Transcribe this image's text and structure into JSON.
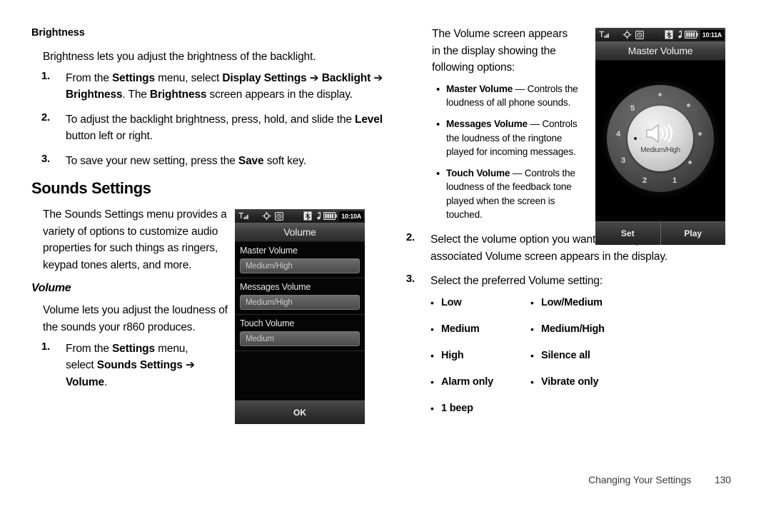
{
  "left_column": {
    "brightness_heading": "Brightness",
    "brightness_intro": "Brightness lets you adjust the brightness of the backlight.",
    "brightness_steps": [
      {
        "num": "1.",
        "parts": [
          {
            "t": "From the ",
            "b": false
          },
          {
            "t": "Settings",
            "b": true
          },
          {
            "t": " menu, select ",
            "b": false
          },
          {
            "t": "Display Settings ➔",
            "b": true
          },
          {
            "t": " ",
            "b": false
          },
          {
            "t": "Backlight ➔ Brightness",
            "b": true
          },
          {
            "t": ". The ",
            "b": false
          },
          {
            "t": "Brightness",
            "b": true
          },
          {
            "t": " screen appears in the display.",
            "b": false
          }
        ]
      },
      {
        "num": "2.",
        "parts": [
          {
            "t": "To adjust the backlight brightness, press, hold, and slide the ",
            "b": false
          },
          {
            "t": "Level",
            "b": true
          },
          {
            "t": " button left or right.",
            "b": false
          }
        ]
      },
      {
        "num": "3.",
        "parts": [
          {
            "t": "To save your new setting, press the ",
            "b": false
          },
          {
            "t": "Save",
            "b": true
          },
          {
            "t": " soft key.",
            "b": false
          }
        ]
      }
    ],
    "sounds_heading": "Sounds Settings",
    "sounds_intro": "The Sounds Settings menu provides a variety of options to customize audio properties for such things as ringers, keypad tones alerts, and more.",
    "volume_heading": "Volume",
    "volume_intro": "Volume lets you adjust the loudness of the sounds your r860 produces.",
    "volume_steps": [
      {
        "num": "1.",
        "parts": [
          {
            "t": "From the ",
            "b": false
          },
          {
            "t": "Settings",
            "b": true
          },
          {
            "t": " menu, select ",
            "b": false
          },
          {
            "t": "Sounds Settings ➔",
            "b": true
          },
          {
            "t": " ",
            "b": false
          },
          {
            "t": "Volume",
            "b": true
          },
          {
            "t": ".",
            "b": false
          }
        ]
      }
    ]
  },
  "right_column": {
    "intro": "The Volume screen appears in the display showing the following options:",
    "option_bullets": [
      {
        "dot": "•",
        "lead": "Master Volume",
        "rest": " — Controls the loudness of all phone sounds."
      },
      {
        "dot": "•",
        "lead": "Messages Volume",
        "rest": " — Controls the loudness of the ringtone played for incoming messages."
      },
      {
        "dot": "•",
        "lead": "Touch Volume",
        "rest": " — Controls the loudness of the feedback tone played when the screen is touched."
      }
    ],
    "steps": [
      {
        "num": "2.",
        "parts": [
          {
            "t": "Select the volume option you want to change. The associated Volume screen appears in the display.",
            "b": false
          }
        ]
      },
      {
        "num": "3.",
        "parts": [
          {
            "t": "Select the preferred Volume setting:",
            "b": false
          }
        ]
      }
    ],
    "setting_bullets_col1": [
      {
        "dot": "•",
        "label": "Low"
      },
      {
        "dot": "•",
        "label": "Medium"
      },
      {
        "dot": "•",
        "label": "High"
      },
      {
        "dot": "•",
        "label": "Alarm only"
      },
      {
        "dot": "•",
        "label": "1 beep"
      }
    ],
    "setting_bullets_col2": [
      {
        "dot": "•",
        "label": "Low/Medium"
      },
      {
        "dot": "•",
        "label": "Medium/High"
      },
      {
        "dot": "•",
        "label": "Silence all"
      },
      {
        "dot": "•",
        "label": "Vibrate only"
      }
    ]
  },
  "phone_volume_list": {
    "status": {
      "signal_icon": "signal-bars-icon",
      "gps_icon": "gps-icon",
      "alarm_icon": "alarm-icon",
      "bluetooth_icon": "bluetooth-icon",
      "music_icon": "music-note-icon",
      "battery_icon": "battery-icon",
      "time": "10:10A"
    },
    "title": "Volume",
    "rows": [
      {
        "label": "Master Volume",
        "value": "Medium/High"
      },
      {
        "label": "Messages Volume",
        "value": "Medium/High"
      },
      {
        "label": "Touch Volume",
        "value": "Medium"
      }
    ],
    "softkey_ok": "OK"
  },
  "phone_master_volume": {
    "status": {
      "signal_icon": "signal-bars-icon",
      "gps_icon": "gps-icon",
      "alarm_icon": "alarm-icon",
      "bluetooth_icon": "bluetooth-icon",
      "music_icon": "music-note-icon",
      "battery_icon": "battery-icon",
      "time": "10:11A"
    },
    "title": "Master Volume",
    "dial": {
      "numbers": [
        "1",
        "2",
        "3",
        "4",
        "5"
      ],
      "current_label": "Medium/High",
      "speaker_icon": "speaker-volume-icon"
    },
    "softkey_set": "Set",
    "softkey_play": "Play"
  },
  "footer": {
    "chapter": "Changing Your Settings",
    "page": "130"
  },
  "colors": {
    "page_bg": "#ffffff",
    "text": "#000000",
    "footer_text": "#3a3a3a",
    "screen_bg": "#050505"
  }
}
